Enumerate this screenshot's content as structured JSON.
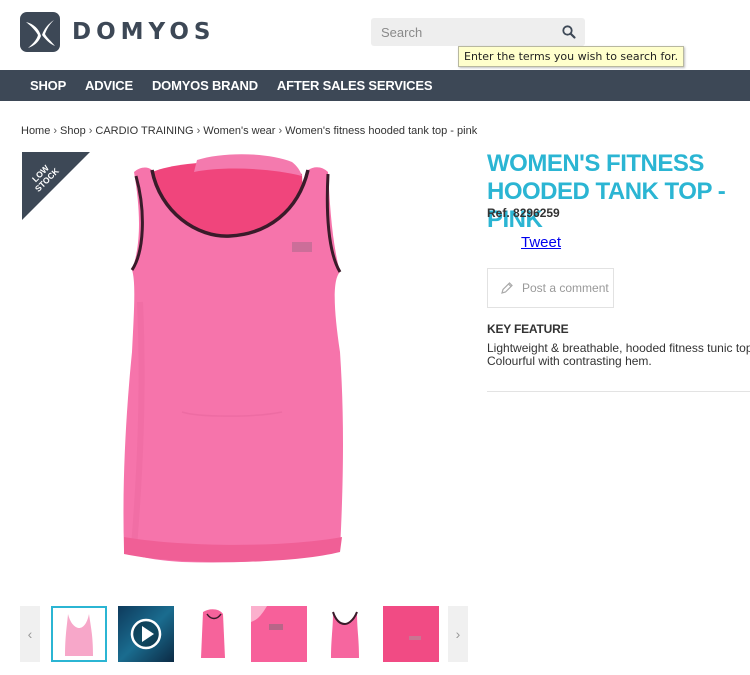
{
  "brand": {
    "name": "DOMYOS"
  },
  "search": {
    "placeholder": "Search",
    "tooltip": "Enter the terms you wish to search for."
  },
  "nav": {
    "items": [
      {
        "label": "SHOP"
      },
      {
        "label": "ADVICE"
      },
      {
        "label": "DOMYOS BRAND"
      },
      {
        "label": "AFTER SALES SERVICES"
      }
    ]
  },
  "breadcrumb": {
    "items": [
      "Home",
      "Shop",
      "CARDIO TRAINING",
      "Women's wear",
      "Women's fitness hooded tank top - pink"
    ],
    "separator": "›"
  },
  "badge": {
    "line1": "LOW",
    "line2": "STOCK"
  },
  "product": {
    "title": "WOMEN'S FITNESS HOODED TANK TOP -\nPINK",
    "ref_label": "Ref.",
    "ref_value": "8296259",
    "tweet_label": "Tweet",
    "comment_label": "Post a comment",
    "key_feature_label": "KEY FEATURE",
    "key_feature_line1": "Lightweight & breathable, hooded fitness tunic top.",
    "key_feature_line2": "Colourful with contrasting hem."
  },
  "thumbnails": {
    "prev": "‹",
    "next": "›"
  },
  "colors": {
    "nav_bg": "#3d4856",
    "accent": "#2bb5d3",
    "product_pink": "#f46faa",
    "hot_pink": "#f0497f"
  }
}
